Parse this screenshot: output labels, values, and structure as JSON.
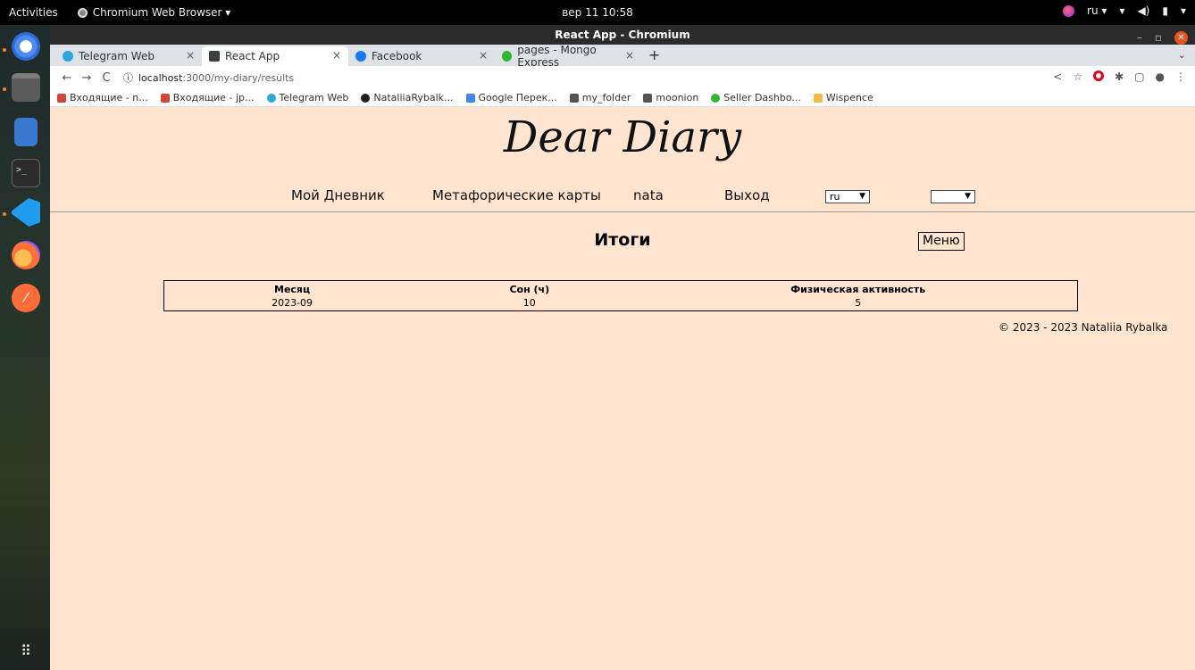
{
  "system": {
    "activities_label": "Activities",
    "app_menu_label": "Chromium Web Browser ▾",
    "clock": "вер 11  10:58",
    "keyboard_layout": "ru ▾",
    "tray_icons": [
      "wifi-icon",
      "volume-icon",
      "battery-icon",
      "system-menu-icon"
    ]
  },
  "dock": {
    "items": [
      "chromium-icon",
      "files-icon",
      "text-editor-icon",
      "terminal-icon",
      "vscode-icon",
      "firefox-icon",
      "postman-icon",
      "app-grid-icon"
    ]
  },
  "window": {
    "title": "React App - Chromium"
  },
  "tabs": [
    {
      "label": "Telegram Web",
      "color": "#2ca5e0"
    },
    {
      "label": "React App",
      "color": "#3a3f44"
    },
    {
      "label": "Facebook",
      "color": "#1877f2"
    },
    {
      "label": "pages - Mongo Express",
      "color": "#2eb82e"
    }
  ],
  "address": {
    "host": "localhost",
    "path": ":3000/my-diary/results"
  },
  "bookmarks": [
    {
      "label": "Входящие - n...",
      "color": "#d44638"
    },
    {
      "label": "Входящие - jp...",
      "color": "#d44638"
    },
    {
      "label": "Telegram Web",
      "color": "#2ca5e0"
    },
    {
      "label": "NataliiaRybalk...",
      "color": "#222222"
    },
    {
      "label": "Google Перек...",
      "color": "#4285f4"
    },
    {
      "label": "my_folder",
      "color": "#555555"
    },
    {
      "label": "moonion",
      "color": "#555555"
    },
    {
      "label": "Seller Dashbo...",
      "color": "#2eb82e"
    },
    {
      "label": "Wispence",
      "color": "#f5b942"
    }
  ],
  "site": {
    "title": "Dear Diary",
    "nav": {
      "diary": "Мой Дневник",
      "cards": "Метафорические карты",
      "user": "nata",
      "logout": "Выход",
      "language_value": "ru",
      "second_select_value": ""
    },
    "results_title": "Итоги",
    "menu_button": "Меню",
    "table": {
      "headers": [
        "Месяц",
        "Сон (ч)",
        "Физическая активность"
      ],
      "rows": [
        [
          "2023-09",
          "10",
          "5"
        ]
      ]
    },
    "footer": "© 2023 - 2023 Nataliia Rybalka"
  }
}
